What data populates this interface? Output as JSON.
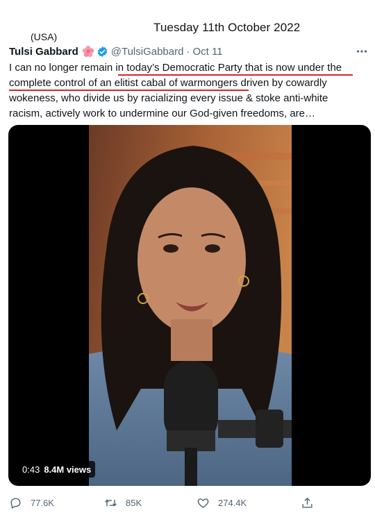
{
  "annotations": {
    "date": "Tuesday 11th October 2022",
    "country": "(USA)"
  },
  "tweet": {
    "display_name": "Tulsi Gabbard",
    "handle": "@TulsiGabbard",
    "separator": "·",
    "time": "Oct 11",
    "text_lines": [
      "I can no longer remain in today’s Democratic Party that is now under the",
      "complete control of an elitist cabal of warmongers driven by cowardly",
      "wokeness, who divide us by racializing every issue & stoke anti-white",
      "racism, actively work to undermine our God-given freedoms, are…"
    ],
    "icons": {
      "flower": "hibiscus-emoji-icon",
      "verified": "verified-badge-icon",
      "more": "more-options-icon"
    }
  },
  "media": {
    "duration": "0:43",
    "views": "8.4M views"
  },
  "actions": {
    "replies": "77.6K",
    "retweets": "85K",
    "likes": "274.4K"
  },
  "colors": {
    "accent_underline": "#d8232a",
    "verified": "#1d9bf0",
    "secondary_text": "#536471"
  }
}
